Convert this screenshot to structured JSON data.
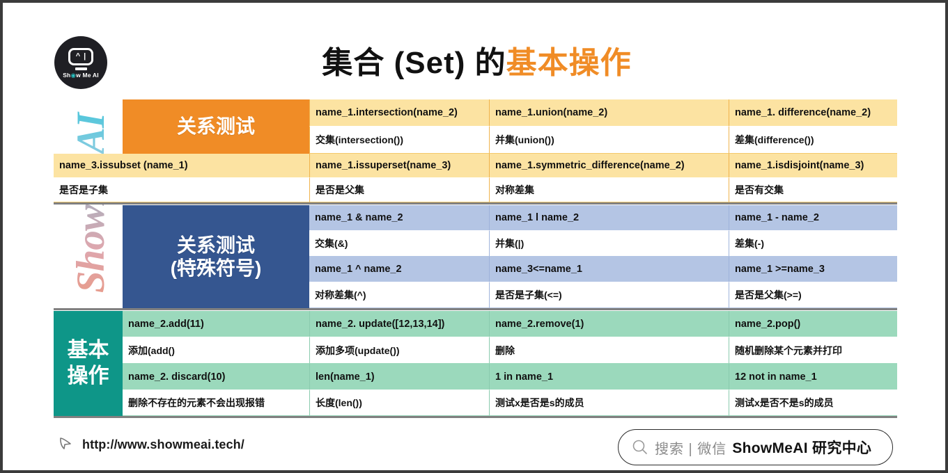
{
  "brand": {
    "logo_text": "Show Me AI",
    "watermark": "ShowMeAI"
  },
  "title": {
    "main": "集合 (Set) 的",
    "accent": "基本操作"
  },
  "sections": [
    {
      "id": "relation-test",
      "header": "关系测试",
      "header_color": "#F08C26",
      "code_row_color": "#FCE3A2",
      "rows": [
        {
          "code": [
            "",
            "name_1.intersection(name_2)",
            "name_1.union(name_2)",
            "name_1. difference(name_2)"
          ],
          "desc": [
            "",
            "交集(intersection())",
            "并集(union())",
            "差集(difference())"
          ]
        },
        {
          "code": [
            "name_3.issubset (name_1)",
            "name_1.issuperset(name_3)",
            "name_1.symmetric_difference(name_2)",
            "name_1.isdisjoint(name_3)"
          ],
          "desc": [
            "是否是子集",
            "是否是父集",
            "对称差集",
            "是否有交集"
          ]
        }
      ]
    },
    {
      "id": "relation-test-symbols",
      "header_line1": "关系测试",
      "header_line2": "(特殊符号)",
      "header_color": "#355690",
      "code_row_color": "#B4C5E4",
      "rows": [
        {
          "code": [
            "name_1 & name_2",
            "name_1 l name_2",
            "name_1 - name_2"
          ],
          "desc": [
            "交集(&)",
            "并集(|)",
            "差集(-)"
          ]
        },
        {
          "code": [
            "name_1 ^ name_2",
            "name_3<=name_1",
            "name_1 >=name_3"
          ],
          "desc": [
            "对称差集(^)",
            "是否是子集(<=)",
            "是否是父集(>=)"
          ]
        }
      ]
    },
    {
      "id": "basic-operations",
      "header_line1": "基本",
      "header_line2": "操作",
      "header_color": "#0E9688",
      "code_row_color": "#9BD9BC",
      "rows": [
        {
          "code": [
            "name_2.add(11)",
            "name_2. update([12,13,14])",
            "name_2.remove(1)",
            "name_2.pop()"
          ],
          "desc": [
            "添加(add()",
            "添加多项(update())",
            "删除",
            "随机删除某个元素并打印"
          ]
        },
        {
          "code": [
            "name_2. discard(10)",
            "len(name_1)",
            "1 in name_1",
            "12 not in name_1"
          ],
          "desc": [
            "删除不存在的元素不会出现报错",
            "长度(len())",
            "测试x是否是s的成员",
            "测试x是否不是s的成员"
          ]
        }
      ]
    }
  ],
  "footer": {
    "url": "http://www.showmeai.tech/",
    "cursor_icon": "cursor-arrow-icon",
    "search": {
      "icon": "search-icon",
      "placeholder": "搜索 | 微信",
      "brand": "ShowMeAI 研究中心"
    }
  },
  "colors": {
    "orange": "#F08C26",
    "navy": "#355690",
    "teal": "#0E9688",
    "light_yellow": "#FCE3A2",
    "light_blue": "#B4C5E4",
    "light_green": "#9BD9BC",
    "frame": "#3b3b3b"
  }
}
